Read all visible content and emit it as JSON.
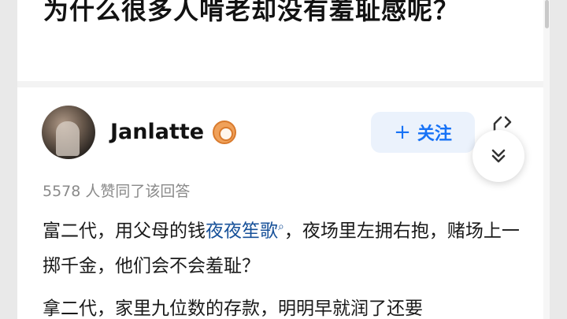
{
  "question": {
    "title": "为什么很多人啃老却没有羞耻感呢？"
  },
  "answer": {
    "author": {
      "name": "Janlatte",
      "avatar": "avatar",
      "badge_icon": "creator-badge-icon"
    },
    "follow_label": "关注",
    "follow_icon": "+",
    "votes_text": "5578 人赞同了该回答",
    "paragraph1": {
      "before": "富二代，用父母的钱",
      "link": "夜夜笙歌",
      "link_icon": "search-icon",
      "after": "，夜场里左拥右抱，赌场上一掷千金，他们会不会羞耻？"
    },
    "paragraph2": {
      "text": "拿二代，家里九位数的存款，明明早就润了还要"
    }
  },
  "colors": {
    "accent": "#1772f6",
    "link": "#175199",
    "follow_bg": "#ebf2fc"
  }
}
